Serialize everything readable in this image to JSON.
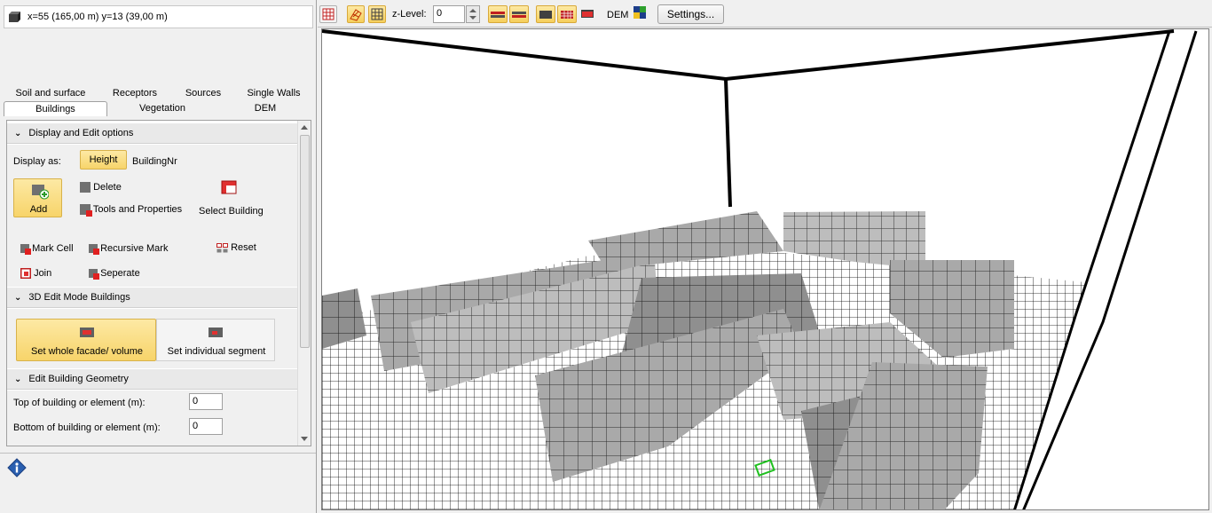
{
  "status": {
    "coordinates": "x=55 (165,00 m) y=13 (39,00 m)"
  },
  "tabs": {
    "row1": [
      "Soil and surface",
      "Receptors",
      "Sources",
      "Single Walls"
    ],
    "row2": [
      "Buildings",
      "Vegetation",
      "DEM"
    ],
    "active": "Buildings"
  },
  "display_edit": {
    "header": "Display and Edit options",
    "display_as_label": "Display as:",
    "height_label": "Height",
    "buildingnr_label": "BuildingNr",
    "add_label": "Add",
    "delete_label": "Delete",
    "tools_label": "Tools and Properties",
    "select_building_label": "Select Building",
    "mark_cell_label": "Mark Cell",
    "recursive_mark_label": "Recursive Mark",
    "reset_label": "Reset",
    "join_label": "Join",
    "seperate_label": "Seperate"
  },
  "edit_3d": {
    "header": "3D Edit Mode Buildings",
    "whole_label": "Set whole facade/ volume",
    "segment_label": "Set individual segment"
  },
  "geometry": {
    "header": "Edit Building Geometry",
    "top_label": "Top of building or element (m):",
    "top_value": "0",
    "bottom_label": "Bottom of building or element (m):",
    "bottom_value": "0"
  },
  "toolbar": {
    "zlevel_label": "z-Level:",
    "zlevel_value": "0",
    "dem_label": "DEM",
    "settings_label": "Settings..."
  },
  "colors": {
    "accent_yellow": "#f7d46a",
    "building_gray": "#a8a8a8",
    "grid_line": "#000000"
  }
}
